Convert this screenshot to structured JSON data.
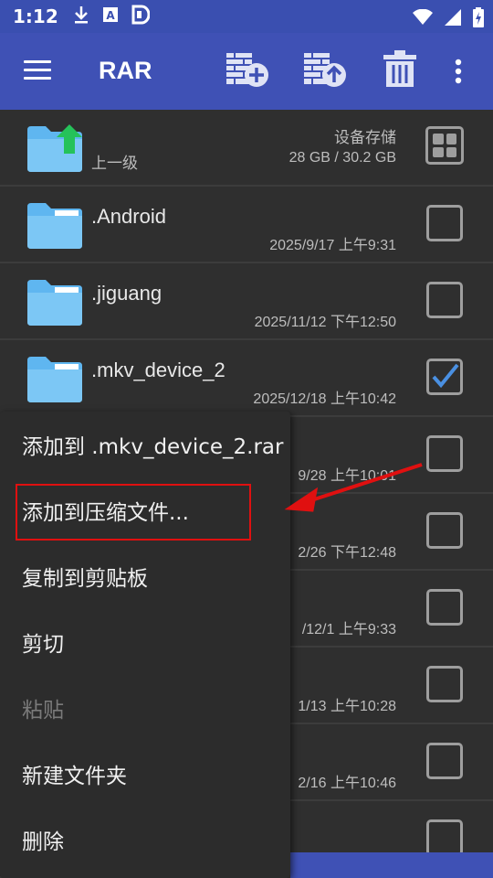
{
  "status_bar": {
    "time": "1:12"
  },
  "app_bar": {
    "title": "RAR",
    "icons": [
      "menu-icon",
      "add-archive-icon",
      "extract-archive-icon",
      "delete-icon",
      "more-icon"
    ]
  },
  "up_row": {
    "label": "上一级",
    "storage_label": "设备存储",
    "storage_value": "28 GB / 30.2 GB"
  },
  "files": [
    {
      "name": ".Android",
      "date": "2025/9/17 上午9:31",
      "checked": false
    },
    {
      "name": ".jiguang",
      "date": "2025/11/12 下午12:50",
      "checked": false
    },
    {
      "name": ".mkv_device_2",
      "date": "2025/12/18 上午10:42",
      "checked": true
    },
    {
      "name": "",
      "date": "9/28 上午10:01",
      "checked": false
    },
    {
      "name": "",
      "date": "2/26 下午12:48",
      "checked": false
    },
    {
      "name": "",
      "date": "/12/1 上午9:33",
      "checked": false
    },
    {
      "name": "",
      "date": "1/13 上午10:28",
      "checked": false
    },
    {
      "name": "",
      "date": "2/16 上午10:46",
      "checked": false
    },
    {
      "name": "",
      "date": "",
      "checked": false
    }
  ],
  "context_menu": {
    "items": [
      {
        "label": "添加到 .mkv_device_2.rar",
        "enabled": true
      },
      {
        "label": "添加到压缩文件...",
        "enabled": true
      },
      {
        "label": "复制到剪贴板",
        "enabled": true
      },
      {
        "label": "剪切",
        "enabled": true
      },
      {
        "label": "粘贴",
        "enabled": false
      },
      {
        "label": "新建文件夹",
        "enabled": true
      },
      {
        "label": "删除",
        "enabled": true
      }
    ]
  },
  "colors": {
    "status_bar": "#3a4fb0",
    "app_bar": "#3f51b5",
    "background": "#2f2f2f",
    "folder": "#5fb6f0",
    "check": "#4a90e2",
    "highlight": "#e01010"
  }
}
